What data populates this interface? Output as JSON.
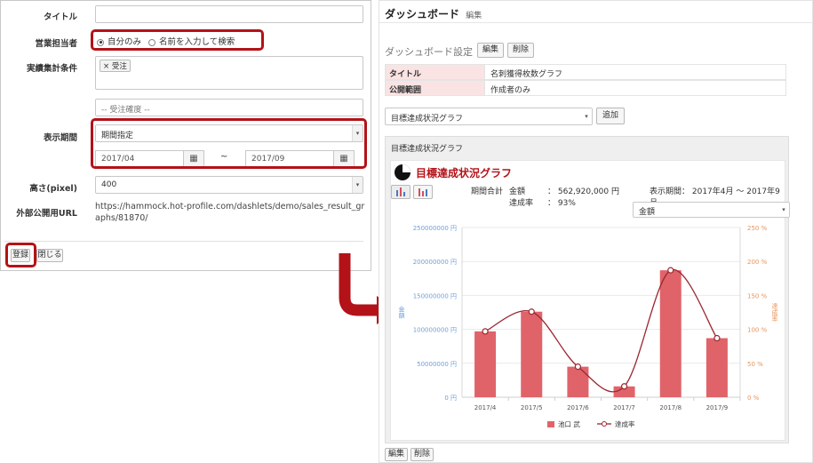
{
  "form": {
    "title_label": "タイトル",
    "title_value": "",
    "sales_owner_label": "営業担当者",
    "radio_self": "自分のみ",
    "radio_name": "名前を入力して検索",
    "criteria_label": "実績集計条件",
    "criteria_tag": "受注",
    "criteria_tag_remove": "×",
    "certainty_placeholder": "-- 受注確度 --",
    "period_label": "表示期間",
    "period_select": "期間指定",
    "date_from": "2017/04",
    "date_tilde": "~",
    "date_to": "2017/09",
    "height_label": "高さ(pixel)",
    "height_value": "400",
    "url_label": "外部公開用URL",
    "url_value": "https://hammock.hot-profile.com/dashlets/demo/sales_result_graphs/81870/",
    "register_button": "登録",
    "close_button": "閉じる"
  },
  "dashboard": {
    "title": "ダッシュボード",
    "edit_link": "編集",
    "settings_label": "ダッシュボード設定",
    "settings_edit": "編集",
    "settings_delete": "削除",
    "rows": [
      {
        "key": "タイトル",
        "value": "名刺獲得枚数グラフ"
      },
      {
        "key": "公開範囲",
        "value": "作成者のみ"
      }
    ],
    "dashlet_select": "目標達成状況グラフ",
    "add_button": "追加",
    "panel_header": "目標達成状況グラフ",
    "widget_title": "目標達成状況グラフ",
    "period_total_label": "期間合計",
    "amount_label": "金額",
    "amount_value": "： 562,920,000 円",
    "rate_label": "達成率",
    "rate_value": "： 93%",
    "display_period": "表示期間： 2017年4月 〜 2017年9月",
    "metric_select": "金額",
    "footer_edit": "編集",
    "footer_delete": "削除",
    "icons": {
      "pie": "pie-chart-icon",
      "bar": "bar-chart-icon",
      "calendar": "calendar-icon"
    }
  },
  "chart_data": {
    "type": "bar",
    "categories": [
      "2017/4",
      "2017/5",
      "2017/6",
      "2017/7",
      "2017/8",
      "2017/9"
    ],
    "series": [
      {
        "name": "池口 武",
        "type": "bar",
        "axis": "left",
        "values": [
          97000000,
          126000000,
          45000000,
          16000000,
          187000000,
          87000000
        ],
        "color": "#e0636a"
      },
      {
        "name": "達成率",
        "type": "line",
        "axis": "right",
        "values": [
          97,
          126,
          45,
          16,
          187,
          87
        ],
        "color": "#9b2630"
      }
    ],
    "ylabel_left": "金額",
    "ylabel_right": "達成率",
    "ylim_left": [
      0,
      250000000
    ],
    "ylim_right": [
      0,
      250
    ],
    "yticks_left": [
      "0 円",
      "50000000 円",
      "100000000 円",
      "150000000 円",
      "200000000 円",
      "250000000 円"
    ],
    "yticks_right": [
      "0 %",
      "50 %",
      "100 %",
      "150 %",
      "200 %",
      "250 %"
    ],
    "grid": true,
    "legend": "bottom"
  },
  "colors": {
    "accent_red": "#b31218",
    "bar": "#e0636a",
    "line": "#9b2630",
    "left_axis": "#6f9fd8",
    "right_axis": "#e8935c"
  }
}
